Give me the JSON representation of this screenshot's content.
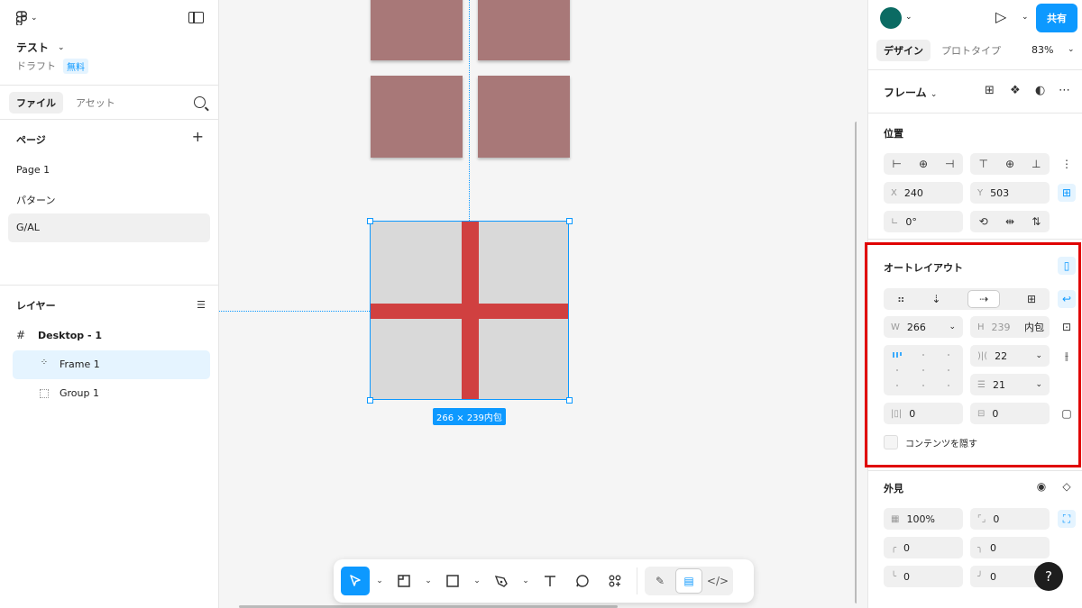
{
  "left_panel": {
    "file_title": "テスト",
    "file_status": "ドラフト",
    "plan_badge": "無料",
    "tabs": [
      "ファイル",
      "アセット"
    ],
    "pages_heading": "ページ",
    "pages": [
      "Page 1",
      "パターン",
      "G/AL"
    ],
    "layers_heading": "レイヤー",
    "layers": [
      "Desktop - 1",
      "Frame 1",
      "Group 1"
    ]
  },
  "canvas": {
    "selection_size": "266 × 239内包"
  },
  "right_panel": {
    "share_label": "共有",
    "tabs": [
      "デザイン",
      "プロトタイプ"
    ],
    "zoom": "83%",
    "frame_label": "フレーム",
    "position": {
      "heading": "位置",
      "x_label": "X",
      "x": "240",
      "y_label": "Y",
      "y": "503",
      "rotation": "0°"
    },
    "auto_layout": {
      "heading": "オートレイアウト",
      "w_label": "W",
      "w": "266",
      "h_label": "H",
      "h": "239",
      "h_mode": "内包",
      "gap_h": "22",
      "gap_v": "21",
      "padding_h": "0",
      "padding_v": "0",
      "clip_label": "コンテンツを隠す"
    },
    "appearance": {
      "heading": "外見",
      "opacity": "100%",
      "radius": "0",
      "radius_tl": "0",
      "radius_tr": "0",
      "radius_bl": "0",
      "radius_br": "0"
    },
    "help": "?"
  },
  "colors": {
    "accent": "#0d99ff",
    "tile": "#a87878",
    "cross": "#d04040",
    "frame_fill": "#d9d9d9",
    "avatar": "#0b6b63",
    "highlight": "#e00000"
  }
}
